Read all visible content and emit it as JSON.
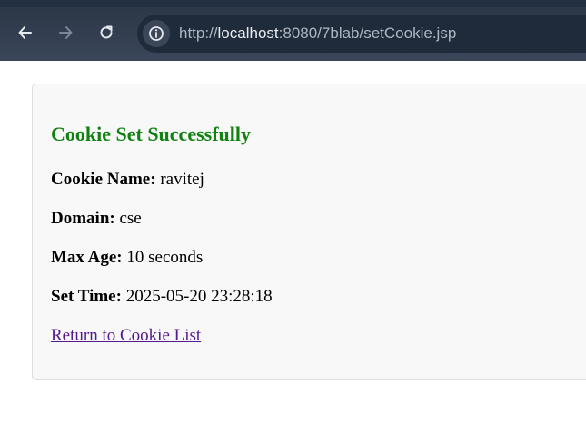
{
  "browser": {
    "url_scheme": "http://",
    "url_host": "localhost",
    "url_rest": ":8080/7blab/setCookie.jsp",
    "icons": {
      "back": "back-arrow-icon",
      "forward": "forward-arrow-icon",
      "reload": "reload-icon",
      "site_info": "info-icon"
    }
  },
  "page": {
    "title": "Cookie Set Successfully",
    "title_color": "#118211",
    "rows": [
      {
        "label": "Cookie Name:",
        "value": " ravitej"
      },
      {
        "label": "Domain:",
        "value": " cse"
      },
      {
        "label": "Max Age:",
        "value": " 10 seconds"
      },
      {
        "label": "Set Time:",
        "value": " 2025-05-20 23:28:18"
      }
    ],
    "link_label": "Return to Cookie List",
    "link_color": "#551a8b"
  }
}
